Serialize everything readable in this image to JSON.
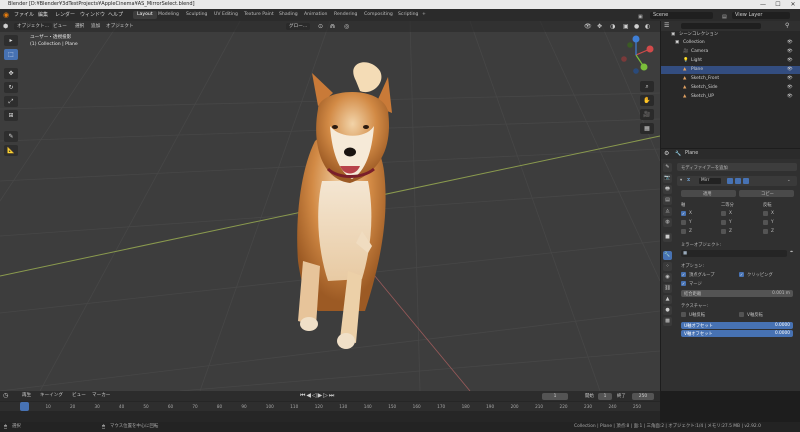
{
  "window": {
    "title": "Blender [D:¥Blender¥3dTestProjects¥AppleCinema¥AS_MirrorSelect.blend]",
    "min": "—",
    "max": "☐",
    "close": "✕"
  },
  "menu": [
    "ファイル",
    "編集",
    "レンダー",
    "ウィンドウ",
    "ヘルプ"
  ],
  "workspaces": [
    "Layout",
    "Modeling",
    "Sculpting",
    "UV Editing",
    "Texture Paint",
    "Shading",
    "Animation",
    "Rendering",
    "Compositing",
    "Scripting",
    "+"
  ],
  "top_right": {
    "scene": "Scene",
    "view_layer": "View Layer"
  },
  "viewport": {
    "mode": "オブジェクト…",
    "view": "ビュー",
    "select": "選択",
    "add": "追加",
    "object": "オブジェクト",
    "global": "グロー…",
    "overlay_title": "ユーザー・透視投影",
    "overlay_sub": "(1) Collection | Plane"
  },
  "tools": [
    "▸",
    "⬚",
    "✥",
    "↻",
    "⤢",
    "⊞",
    "✎",
    "📐"
  ],
  "timeline": {
    "playback": "再生",
    "keying": "キーイング",
    "view": "ビュー",
    "marker": "マーカー",
    "current_frame": "1",
    "start_label": "開始",
    "start": "1",
    "end_label": "終了",
    "end": "250",
    "ticks": [
      "1",
      "10",
      "20",
      "30",
      "40",
      "50",
      "60",
      "70",
      "80",
      "90",
      "100",
      "110",
      "120",
      "130",
      "140",
      "150",
      "160",
      "170",
      "180",
      "190",
      "200",
      "210",
      "220",
      "230",
      "240",
      "250"
    ]
  },
  "status": {
    "left": "選択",
    "middle": "マウス位置を中心に回転",
    "right": "Collection | Plane | 頂点:8 | 面:1 | 三角面:2 | オブジェクト:1/4 | メモリ:27.5 MB | v2.92.0"
  },
  "outliner": {
    "header": "シーンコレクション",
    "items": [
      {
        "label": "Collection",
        "indent": 0
      },
      {
        "label": "Camera",
        "indent": 1
      },
      {
        "label": "Light",
        "indent": 1
      },
      {
        "label": "Plane",
        "indent": 1,
        "selected": true
      },
      {
        "label": "Sketch_Front",
        "indent": 1
      },
      {
        "label": "Sketch_Side",
        "indent": 1
      },
      {
        "label": "Sketch_UP",
        "indent": 1
      }
    ]
  },
  "properties": {
    "object": "Plane",
    "add_modifier": "モディファイアーを追加",
    "modifier_name": "Mirr",
    "apply": "適用",
    "copy": "コピー",
    "axis_label": "軸",
    "bisect_label": "二等分",
    "flip_label": "反転",
    "axes": [
      "X",
      "Y",
      "Z"
    ],
    "mirror_object_label": "ミラーオブジェクト:",
    "options_label": "オプション:",
    "vertex_groups": "頂点グループ",
    "clipping": "クリッピング",
    "merge": "マージ",
    "merge_distance_label": "結合距離",
    "merge_distance": "0.001 m",
    "textures_label": "テクスチャー:",
    "u_flip": "U軸反転",
    "v_flip": "V軸反転",
    "u_offset_label": "U軸オフセット",
    "u_offset": "0.0000",
    "v_offset_label": "V軸オフセット",
    "v_offset": "0.0000"
  }
}
